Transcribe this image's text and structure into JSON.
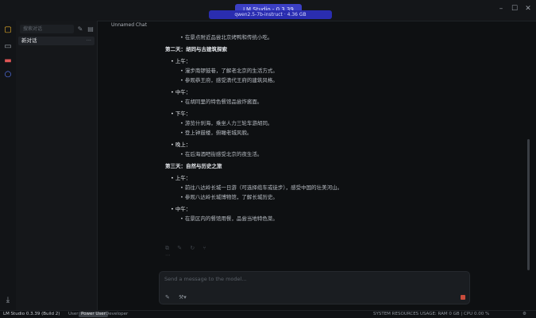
{
  "window": {
    "title": "LM Studio - 0.3.39"
  },
  "model_select": {
    "label": "qwen2.5-7b-instruct · 4.36 GB"
  },
  "sidebar": {
    "search_placeholder": "搜索对话",
    "items": [
      {
        "label": "新对话"
      }
    ]
  },
  "chat": {
    "tab_label": "Unnamed Chat",
    "lines": [
      {
        "kind": "subbullet",
        "text": "在景点附近品尝北京烤鸭和传统小吃。"
      },
      {
        "kind": "heading",
        "text": "第二天：胡同与古建筑探索"
      },
      {
        "kind": "bullet",
        "text": "上午："
      },
      {
        "kind": "subbullet",
        "text": "漫步南锣鼓巷，了解老北京的生活方式。"
      },
      {
        "kind": "subbullet",
        "text": "参观恭王府，感受清代王府的建筑风格。"
      },
      {
        "kind": "bullet",
        "text": "中午："
      },
      {
        "kind": "subbullet",
        "text": "在胡同里的特色餐馆品尝炸酱面。"
      },
      {
        "kind": "bullet",
        "text": "下午："
      },
      {
        "kind": "subbullet",
        "text": "游览什刹海，乘坐人力三轮车游胡同。"
      },
      {
        "kind": "subbullet",
        "text": "登上钟鼓楼，俯瞰老城风貌。"
      },
      {
        "kind": "bullet",
        "text": "晚上："
      },
      {
        "kind": "subbullet",
        "text": "在后海酒吧街感受北京的夜生活。"
      },
      {
        "kind": "heading",
        "text": "第三天：自然与历史之旅"
      },
      {
        "kind": "bullet",
        "text": "上午："
      },
      {
        "kind": "subbullet",
        "text": "前往八达岭长城一日游（可选择缆车或徒步），感受中国的壮美河山。"
      },
      {
        "kind": "subbullet",
        "text": "参观八达岭长城博物馆，了解长城历史。"
      },
      {
        "kind": "bullet",
        "text": "中午："
      },
      {
        "kind": "subbullet",
        "text": "在景区内的餐馆用餐，品尝当地特色菜。"
      }
    ]
  },
  "composer": {
    "placeholder": "Send a message to the model..."
  },
  "statusbar": {
    "app_version": "LM Studio 0.3.39 (Build 2)",
    "modes": [
      {
        "label": "User"
      },
      {
        "label": "Power User"
      },
      {
        "label": "Developer"
      }
    ],
    "right_text": "SYSTEM RESOURCES USAGE: RAM 0 GB | CPU 0.00 %"
  },
  "colors": {
    "accent": "#3b3fc4",
    "send": "#c94c3c"
  }
}
